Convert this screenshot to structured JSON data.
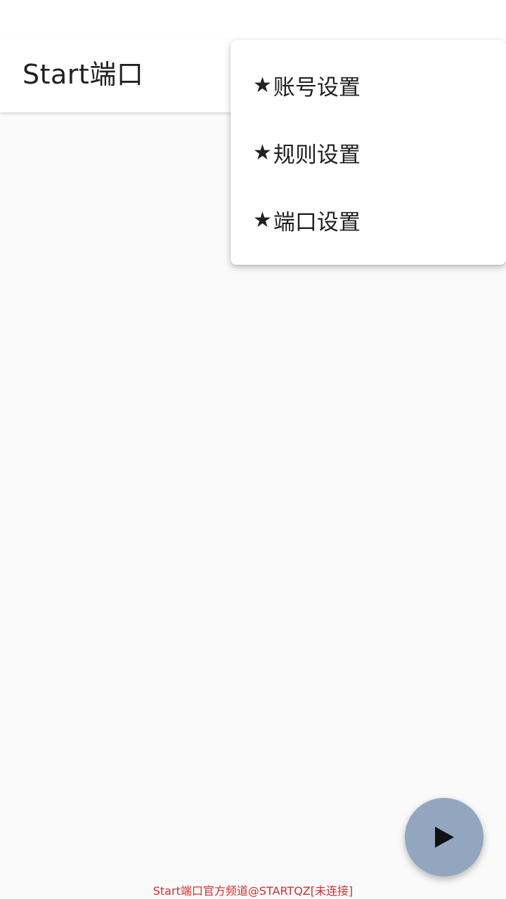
{
  "app_bar": {
    "title": "Start端口"
  },
  "overflow_menu": {
    "items": [
      {
        "star": "★",
        "label": "账号设置"
      },
      {
        "star": "★",
        "label": "规则设置"
      },
      {
        "star": "★",
        "label": "端口设置"
      }
    ]
  },
  "fab": {
    "icon": "play-icon",
    "color": "#92a7bf"
  },
  "footer": {
    "text": "Start端口官方频道@STARTQZ[未连接]",
    "color": "#d32f2f"
  }
}
